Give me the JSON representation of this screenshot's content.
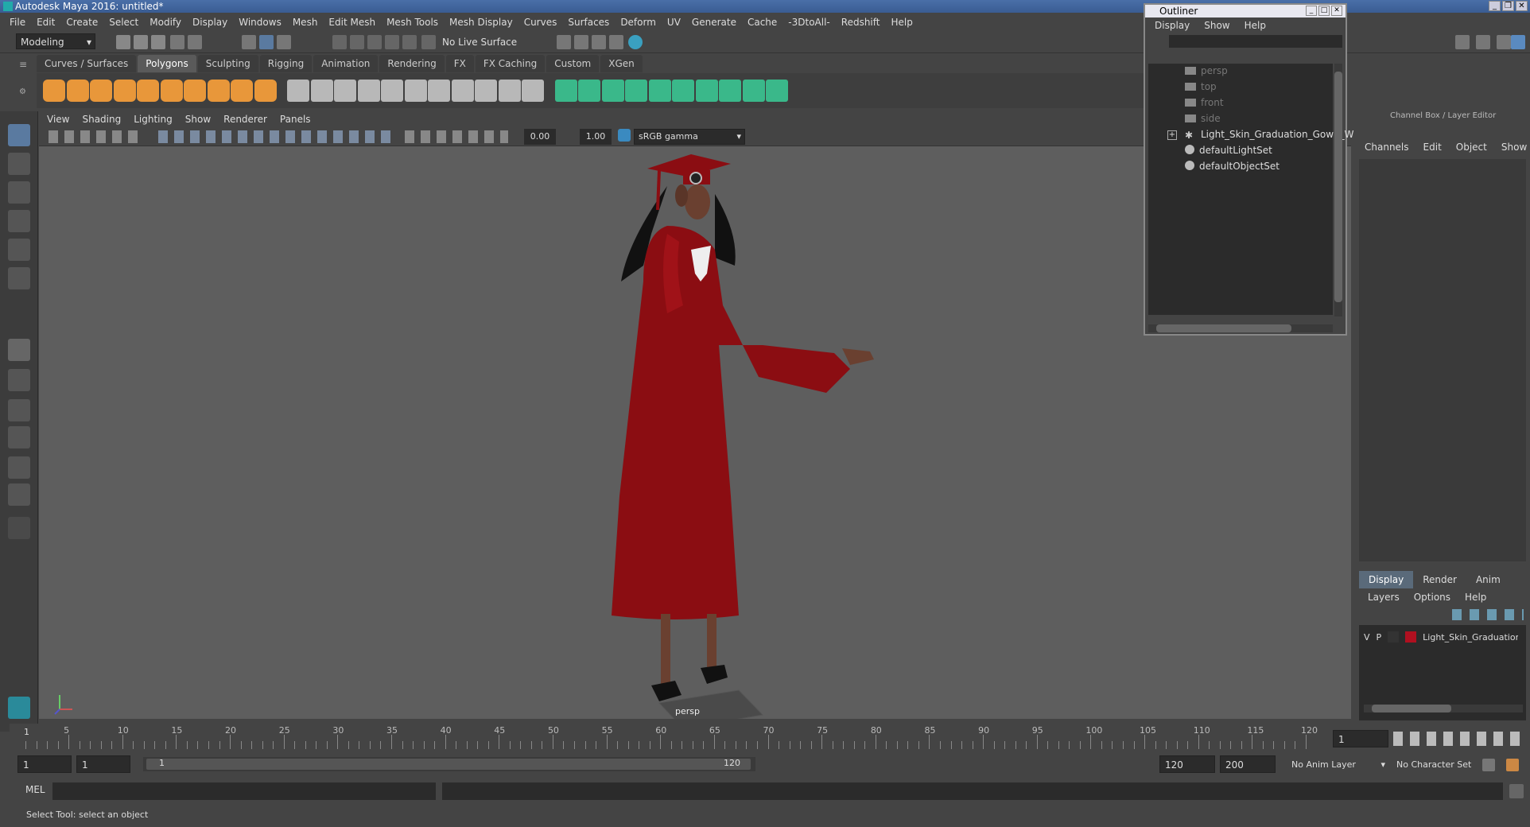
{
  "window": {
    "title": "Autodesk Maya 2016: untitled*"
  },
  "menubar": [
    "File",
    "Edit",
    "Create",
    "Select",
    "Modify",
    "Display",
    "Windows",
    "Mesh",
    "Edit Mesh",
    "Mesh Tools",
    "Mesh Display",
    "Curves",
    "Surfaces",
    "Deform",
    "UV",
    "Generate",
    "Cache",
    "-3DtoAll-",
    "Redshift",
    "Help"
  ],
  "statusline": {
    "mode": "Modeling",
    "live_surface": "No Live Surface"
  },
  "shelf_tabs": [
    "Curves / Surfaces",
    "Polygons",
    "Sculpting",
    "Rigging",
    "Animation",
    "Rendering",
    "FX",
    "FX Caching",
    "Custom",
    "XGen"
  ],
  "shelf_active": "Polygons",
  "viewport": {
    "menu": [
      "View",
      "Shading",
      "Lighting",
      "Show",
      "Renderer",
      "Panels"
    ],
    "exposure": "0.00",
    "gamma": "1.00",
    "color_space": "sRGB gamma",
    "camera_label": "persp"
  },
  "outliner": {
    "title": "Outliner",
    "menu": [
      "Display",
      "Show",
      "Help"
    ],
    "items": [
      {
        "label": "persp",
        "dim": true
      },
      {
        "label": "top",
        "dim": true
      },
      {
        "label": "front",
        "dim": true
      },
      {
        "label": "side",
        "dim": true
      },
      {
        "label": "Light_Skin_Graduation_Gown_W",
        "dim": false
      },
      {
        "label": "defaultLightSet",
        "dim": false
      },
      {
        "label": "defaultObjectSet",
        "dim": false
      }
    ]
  },
  "channel_box": {
    "title": "Channel Box / Layer Editor",
    "menu": [
      "Channels",
      "Edit",
      "Object",
      "Show"
    ],
    "tabs": [
      "Display",
      "Render",
      "Anim"
    ],
    "layer_menu": [
      "Layers",
      "Options",
      "Help"
    ],
    "layer": {
      "v": "V",
      "p": "P",
      "name": "Light_Skin_Graduation",
      "color": "#b01020"
    }
  },
  "timeline": {
    "ticks": [
      "5",
      "10",
      "15",
      "20",
      "25",
      "30",
      "35",
      "40",
      "45",
      "50",
      "55",
      "60",
      "65",
      "70",
      "75",
      "80",
      "85",
      "90",
      "95",
      "100",
      "105",
      "110",
      "115",
      "120"
    ],
    "current_frame_mark": "1",
    "current_frame": "1"
  },
  "range": {
    "start": "1",
    "anim_start": "1",
    "slider_start": "1",
    "slider_end": "120",
    "end": "120",
    "anim_end": "200",
    "anim_layer": "No Anim Layer",
    "char_set": "No Character Set"
  },
  "cmdline": {
    "lang": "MEL"
  },
  "helpline": "Select Tool: select an object",
  "colors": {
    "accent": "#5a6a7a",
    "shelf_orange": "#e8973a",
    "gown": "#8b0d12"
  }
}
